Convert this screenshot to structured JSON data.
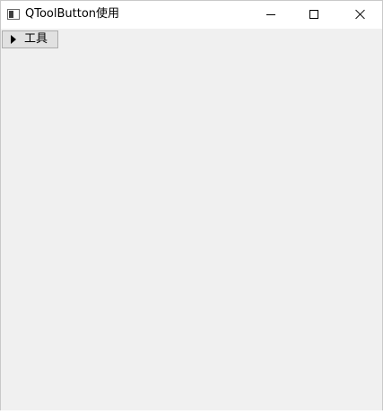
{
  "window": {
    "title": "QToolButton使用"
  },
  "toolbar": {
    "tool_button_label": "工具"
  }
}
